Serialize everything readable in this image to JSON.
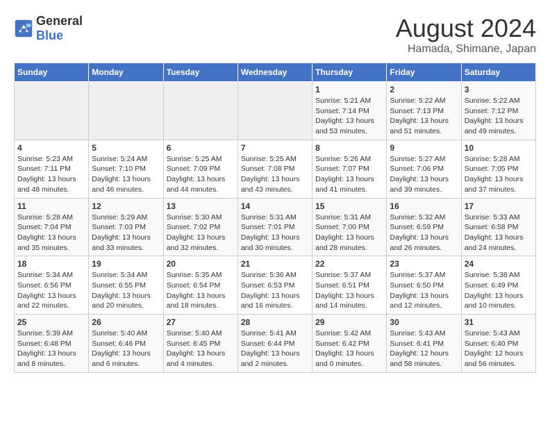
{
  "header": {
    "logo_general": "General",
    "logo_blue": "Blue",
    "title": "August 2024",
    "subtitle": "Hamada, Shimane, Japan"
  },
  "weekdays": [
    "Sunday",
    "Monday",
    "Tuesday",
    "Wednesday",
    "Thursday",
    "Friday",
    "Saturday"
  ],
  "weeks": [
    [
      {
        "day": "",
        "detail": ""
      },
      {
        "day": "",
        "detail": ""
      },
      {
        "day": "",
        "detail": ""
      },
      {
        "day": "",
        "detail": ""
      },
      {
        "day": "1",
        "detail": "Sunrise: 5:21 AM\nSunset: 7:14 PM\nDaylight: 13 hours\nand 53 minutes."
      },
      {
        "day": "2",
        "detail": "Sunrise: 5:22 AM\nSunset: 7:13 PM\nDaylight: 13 hours\nand 51 minutes."
      },
      {
        "day": "3",
        "detail": "Sunrise: 5:22 AM\nSunset: 7:12 PM\nDaylight: 13 hours\nand 49 minutes."
      }
    ],
    [
      {
        "day": "4",
        "detail": "Sunrise: 5:23 AM\nSunset: 7:11 PM\nDaylight: 13 hours\nand 48 minutes."
      },
      {
        "day": "5",
        "detail": "Sunrise: 5:24 AM\nSunset: 7:10 PM\nDaylight: 13 hours\nand 46 minutes."
      },
      {
        "day": "6",
        "detail": "Sunrise: 5:25 AM\nSunset: 7:09 PM\nDaylight: 13 hours\nand 44 minutes."
      },
      {
        "day": "7",
        "detail": "Sunrise: 5:25 AM\nSunset: 7:08 PM\nDaylight: 13 hours\nand 43 minutes."
      },
      {
        "day": "8",
        "detail": "Sunrise: 5:26 AM\nSunset: 7:07 PM\nDaylight: 13 hours\nand 41 minutes."
      },
      {
        "day": "9",
        "detail": "Sunrise: 5:27 AM\nSunset: 7:06 PM\nDaylight: 13 hours\nand 39 minutes."
      },
      {
        "day": "10",
        "detail": "Sunrise: 5:28 AM\nSunset: 7:05 PM\nDaylight: 13 hours\nand 37 minutes."
      }
    ],
    [
      {
        "day": "11",
        "detail": "Sunrise: 5:28 AM\nSunset: 7:04 PM\nDaylight: 13 hours\nand 35 minutes."
      },
      {
        "day": "12",
        "detail": "Sunrise: 5:29 AM\nSunset: 7:03 PM\nDaylight: 13 hours\nand 33 minutes."
      },
      {
        "day": "13",
        "detail": "Sunrise: 5:30 AM\nSunset: 7:02 PM\nDaylight: 13 hours\nand 32 minutes."
      },
      {
        "day": "14",
        "detail": "Sunrise: 5:31 AM\nSunset: 7:01 PM\nDaylight: 13 hours\nand 30 minutes."
      },
      {
        "day": "15",
        "detail": "Sunrise: 5:31 AM\nSunset: 7:00 PM\nDaylight: 13 hours\nand 28 minutes."
      },
      {
        "day": "16",
        "detail": "Sunrise: 5:32 AM\nSunset: 6:59 PM\nDaylight: 13 hours\nand 26 minutes."
      },
      {
        "day": "17",
        "detail": "Sunrise: 5:33 AM\nSunset: 6:58 PM\nDaylight: 13 hours\nand 24 minutes."
      }
    ],
    [
      {
        "day": "18",
        "detail": "Sunrise: 5:34 AM\nSunset: 6:56 PM\nDaylight: 13 hours\nand 22 minutes."
      },
      {
        "day": "19",
        "detail": "Sunrise: 5:34 AM\nSunset: 6:55 PM\nDaylight: 13 hours\nand 20 minutes."
      },
      {
        "day": "20",
        "detail": "Sunrise: 5:35 AM\nSunset: 6:54 PM\nDaylight: 13 hours\nand 18 minutes."
      },
      {
        "day": "21",
        "detail": "Sunrise: 5:36 AM\nSunset: 6:53 PM\nDaylight: 13 hours\nand 16 minutes."
      },
      {
        "day": "22",
        "detail": "Sunrise: 5:37 AM\nSunset: 6:51 PM\nDaylight: 13 hours\nand 14 minutes."
      },
      {
        "day": "23",
        "detail": "Sunrise: 5:37 AM\nSunset: 6:50 PM\nDaylight: 13 hours\nand 12 minutes."
      },
      {
        "day": "24",
        "detail": "Sunrise: 5:38 AM\nSunset: 6:49 PM\nDaylight: 13 hours\nand 10 minutes."
      }
    ],
    [
      {
        "day": "25",
        "detail": "Sunrise: 5:39 AM\nSunset: 6:48 PM\nDaylight: 13 hours\nand 8 minutes."
      },
      {
        "day": "26",
        "detail": "Sunrise: 5:40 AM\nSunset: 6:46 PM\nDaylight: 13 hours\nand 6 minutes."
      },
      {
        "day": "27",
        "detail": "Sunrise: 5:40 AM\nSunset: 6:45 PM\nDaylight: 13 hours\nand 4 minutes."
      },
      {
        "day": "28",
        "detail": "Sunrise: 5:41 AM\nSunset: 6:44 PM\nDaylight: 13 hours\nand 2 minutes."
      },
      {
        "day": "29",
        "detail": "Sunrise: 5:42 AM\nSunset: 6:42 PM\nDaylight: 13 hours\nand 0 minutes."
      },
      {
        "day": "30",
        "detail": "Sunrise: 5:43 AM\nSunset: 6:41 PM\nDaylight: 12 hours\nand 58 minutes."
      },
      {
        "day": "31",
        "detail": "Sunrise: 5:43 AM\nSunset: 6:40 PM\nDaylight: 12 hours\nand 56 minutes."
      }
    ]
  ]
}
